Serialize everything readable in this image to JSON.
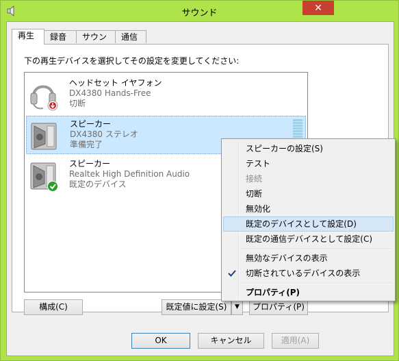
{
  "window": {
    "title": "サウンド",
    "close_glyph": "✕"
  },
  "tabs": [
    {
      "label": "再生",
      "active": true
    },
    {
      "label": "録音",
      "active": false
    },
    {
      "label": "サウンド",
      "active": false
    },
    {
      "label": "通信",
      "active": false
    }
  ],
  "instruction": "下の再生デバイスを選択してその設定を変更してください:",
  "devices": [
    {
      "name": "ヘッドセット イヤフォン",
      "model": "DX4380 Hands-Free",
      "status": "切断",
      "icon": "headset-icon",
      "badge": "disconnected-arrow-icon",
      "selected": false
    },
    {
      "name": "スピーカー",
      "model": "DX4380 ステレオ",
      "status": "準備完了",
      "icon": "speaker-icon",
      "badge": "",
      "selected": true
    },
    {
      "name": "スピーカー",
      "model": "Realtek High Definition Audio",
      "status": "既定のデバイス",
      "icon": "speaker-icon",
      "badge": "default-check-icon",
      "selected": false
    }
  ],
  "buttons": {
    "configure": "構成(C)",
    "set_default": "既定値に設定(S)",
    "properties": "プロパティ(P)",
    "ok": "OK",
    "cancel": "キャンセル",
    "apply": "適用(A)"
  },
  "context_menu": {
    "items": [
      {
        "label": "スピーカーの設定(S)",
        "disabled": false
      },
      {
        "label": "テスト",
        "disabled": false
      },
      {
        "label": "接続",
        "disabled": true
      },
      {
        "label": "切断",
        "disabled": false
      },
      {
        "label": "無効化",
        "disabled": false
      },
      {
        "label": "既定のデバイスとして設定(D)",
        "disabled": false,
        "hover": true
      },
      {
        "label": "既定の通信デバイスとして設定(C)",
        "disabled": false
      },
      {
        "label": "無効なデバイスの表示",
        "disabled": false
      },
      {
        "label": "切断されているデバイスの表示",
        "disabled": false,
        "checked": true
      },
      {
        "label": "プロパティ(P)",
        "disabled": false,
        "bold": true
      }
    ]
  },
  "colors": {
    "frame": "#aee34a",
    "close": "#c74030",
    "selection": "#cce8ff",
    "menu_hover": "#d5e6f7"
  }
}
